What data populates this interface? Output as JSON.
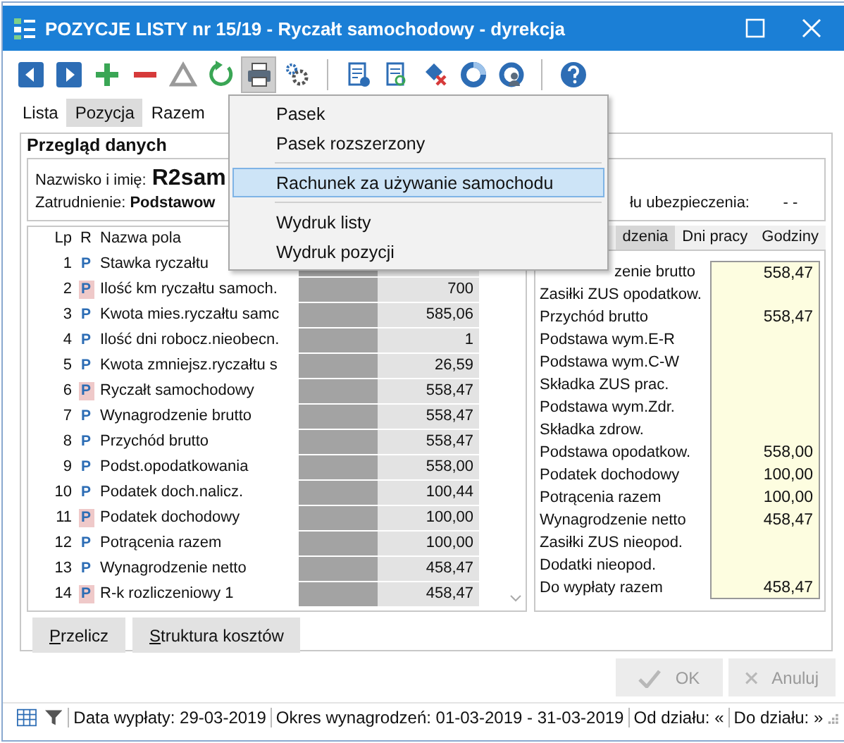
{
  "window": {
    "title": "POZYCJE LISTY nr 15/19 - Ryczałt samochodowy - dyrekcja"
  },
  "toolbar": [
    {
      "kind": "prev",
      "pressed": false
    },
    {
      "kind": "next",
      "pressed": false
    },
    {
      "kind": "add",
      "pressed": false
    },
    {
      "kind": "remove",
      "pressed": false
    },
    {
      "kind": "warning",
      "pressed": false
    },
    {
      "kind": "refresh",
      "pressed": false
    },
    {
      "kind": "print",
      "pressed": true
    },
    {
      "kind": "gears",
      "pressed": false
    },
    {
      "kind": "sep"
    },
    {
      "kind": "report",
      "pressed": false
    },
    {
      "kind": "report-search",
      "pressed": false
    },
    {
      "kind": "delete",
      "pressed": false
    },
    {
      "kind": "ring",
      "pressed": false
    },
    {
      "kind": "ring-person",
      "pressed": false
    },
    {
      "kind": "sep"
    },
    {
      "kind": "help",
      "pressed": false
    }
  ],
  "tabs": [
    {
      "label": "Lista",
      "selected": false
    },
    {
      "label": "Pozycja",
      "selected": true
    },
    {
      "label": "Razem",
      "selected": false
    }
  ],
  "group_title": "Przegląd danych",
  "employee": {
    "name_label": "Nazwisko i imię:",
    "name": "R2sam",
    "employment_label": "Zatrudnienie:",
    "employment": "Podstawow",
    "insurance_label": "łu ubezpieczenia:",
    "insurance": "- -"
  },
  "table": {
    "columns": [
      "Lp",
      "R",
      "Nazwa pola"
    ],
    "rows": [
      {
        "lp": "1",
        "r": "P",
        "marked": false,
        "name": "Stawka ryczałtu",
        "value": ""
      },
      {
        "lp": "2",
        "r": "P",
        "marked": true,
        "name": "Ilość km ryczałtu samoch.",
        "value": "700"
      },
      {
        "lp": "3",
        "r": "P",
        "marked": false,
        "name": "Kwota mies.ryczałtu samc",
        "value": "585,06"
      },
      {
        "lp": "4",
        "r": "P",
        "marked": false,
        "name": "Ilość dni robocz.nieobecn.",
        "value": "1"
      },
      {
        "lp": "5",
        "r": "P",
        "marked": false,
        "name": "Kwota zmniejsz.ryczałtu s",
        "value": "26,59"
      },
      {
        "lp": "6",
        "r": "P",
        "marked": true,
        "name": "Ryczałt samochodowy",
        "value": "558,47"
      },
      {
        "lp": "7",
        "r": "P",
        "marked": false,
        "name": "Wynagrodzenie brutto",
        "value": "558,47"
      },
      {
        "lp": "8",
        "r": "P",
        "marked": false,
        "name": "Przychód brutto",
        "value": "558,47"
      },
      {
        "lp": "9",
        "r": "P",
        "marked": false,
        "name": "Podst.opodatkowania",
        "value": "558,00"
      },
      {
        "lp": "10",
        "r": "P",
        "marked": false,
        "name": "Podatek doch.nalicz.",
        "value": "100,44"
      },
      {
        "lp": "11",
        "r": "P",
        "marked": true,
        "name": "Podatek dochodowy",
        "value": "100,00"
      },
      {
        "lp": "12",
        "r": "P",
        "marked": false,
        "name": "Potrącenia razem",
        "value": "100,00"
      },
      {
        "lp": "13",
        "r": "P",
        "marked": false,
        "name": "Wynagrodzenie netto",
        "value": "458,47"
      },
      {
        "lp": "14",
        "r": "P",
        "marked": true,
        "name": "R-k rozliczeniowy 1",
        "value": "458,47"
      }
    ]
  },
  "side_tabs": [
    {
      "label": "dzenia",
      "selected": true
    },
    {
      "label": "Dni pracy",
      "selected": false
    },
    {
      "label": "Godziny",
      "selected": false
    }
  ],
  "side_rows": [
    {
      "label": "zenie brutto",
      "value": "558,47"
    },
    {
      "label": "Zasiłki ZUS opodatkow.",
      "value": ""
    },
    {
      "label": "Przychód brutto",
      "value": "558,47"
    },
    {
      "label": "Podstawa wym.E-R",
      "value": ""
    },
    {
      "label": "Podstawa wym.C-W",
      "value": ""
    },
    {
      "label": "Składka ZUS prac.",
      "value": ""
    },
    {
      "label": "Podstawa wym.Zdr.",
      "value": ""
    },
    {
      "label": "Składka zdrow.",
      "value": ""
    },
    {
      "label": "Podstawa opodatkow.",
      "value": "558,00"
    },
    {
      "label": "Podatek dochodowy",
      "value": "100,00"
    },
    {
      "label": "Potrącenia razem",
      "value": "100,00"
    },
    {
      "label": "Wynagrodzenie netto",
      "value": "458,47"
    },
    {
      "label": "Zasiłki ZUS nieopod.",
      "value": ""
    },
    {
      "label": "Dodatki nieopod.",
      "value": ""
    },
    {
      "label": "Do wypłaty razem",
      "value": "458,47"
    }
  ],
  "buttons": [
    "Przelicz",
    "Struktura kosztów"
  ],
  "dialog_buttons": [
    {
      "kind": "ok",
      "label": "OK",
      "disabled": true
    },
    {
      "kind": "cancel",
      "label": "Anuluj",
      "disabled": true
    }
  ],
  "status_bar": [
    "Data wypłaty: 29-03-2019",
    "Okres wynagrodzeń: 01-03-2019 - 31-03-2019",
    "Od działu: «",
    "Do działu: »"
  ],
  "menu": [
    {
      "kind": "item",
      "label": "Pasek",
      "selected": false
    },
    {
      "kind": "item",
      "label": "Pasek rozszerzony",
      "selected": false
    },
    {
      "kind": "separator"
    },
    {
      "kind": "item",
      "label": "Rachunek za używanie samochodu",
      "selected": true
    },
    {
      "kind": "separator"
    },
    {
      "kind": "item",
      "label": "Wydruk listy",
      "selected": false
    },
    {
      "kind": "item",
      "label": "Wydruk pozycji",
      "selected": false
    }
  ]
}
